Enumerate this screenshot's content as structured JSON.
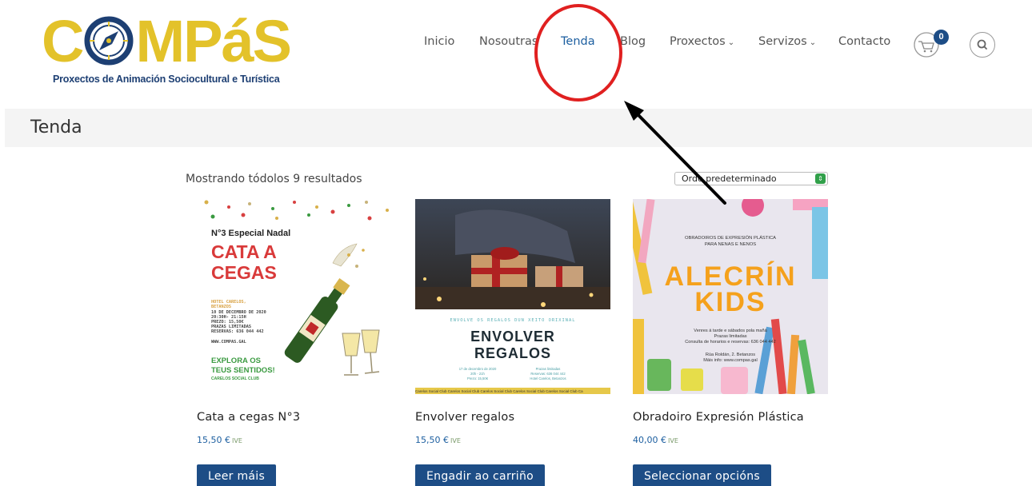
{
  "brand": {
    "logo_word_left": "C",
    "logo_word_right": "MPáS",
    "tagline": "Proxectos de Animación Sociocultural e Turística",
    "logo_color": "#e3c22a",
    "tag_color": "#1d3f73"
  },
  "nav": {
    "items": [
      {
        "label": "Inicio",
        "dropdown": false
      },
      {
        "label": "Nosoutras",
        "dropdown": false
      },
      {
        "label": "Tenda",
        "dropdown": false,
        "active": true
      },
      {
        "label": "Blog",
        "dropdown": false
      },
      {
        "label": "Proxectos",
        "dropdown": true
      },
      {
        "label": "Servizos",
        "dropdown": true
      },
      {
        "label": "Contacto",
        "dropdown": false
      }
    ],
    "cart_count": "0",
    "cart_icon": "cart-icon",
    "search_icon": "search-icon"
  },
  "page": {
    "title": "Tenda"
  },
  "shop": {
    "result_count": "Mostrando tódolos 9 resultados",
    "orderby_selected": "Orde predeterminado",
    "products": [
      {
        "name": "Cata a cegas N°3",
        "price": "15,50 €",
        "tax": "IVE",
        "button": "Leer máis",
        "image": {
          "heading": "N°3 Especial Nadal",
          "title_lines": [
            "CATA A",
            "CEGAS"
          ],
          "details": [
            "HOTEL CARELOS,",
            "BETANZOS",
            "10 DE DECEMBRO DE 2020",
            "20:30H- 21:15H",
            "PREZO: 15,50€",
            "PRAZAS LIMITADAS",
            "RESERVAS: 636 044 442"
          ],
          "web": "WWW.COMPAS.GAL",
          "cta_lines": [
            "EXPLORA OS",
            "TEUS SENTIDOS!"
          ],
          "footer": "CARELOS SOCIAL CLUB"
        }
      },
      {
        "name": "Envolver regalos",
        "price": "15,50 €",
        "tax": "IVE",
        "button": "Engadir ao carriño",
        "image": {
          "subtitle": "ENVOLVE OS REGALOS DUN XEITO ORIXINAL",
          "title_lines": [
            "ENVOLVER",
            "REGALOS"
          ],
          "left_info": [
            "17 de decembro de 2020",
            "20h - 21h",
            "Prezo: 15,50€"
          ],
          "right_info": [
            "Prazas limitadas",
            "Reservas: 636 044 442",
            "Hotel Carelos, Betanzos"
          ],
          "footer": "Carelos Social Club  Carelos Social Club  Carelos Social Club  Carelos Social Club  Carelos Social Club  Ca"
        }
      },
      {
        "name": "Obradoiro Expresión Plástica",
        "price": "40,00 €",
        "tax": "IVE",
        "button": "Seleccionar opcións",
        "image": {
          "subtitle_lines": [
            "OBRADOIROS DE EXPRESIÓN PLÁSTICA",
            "PARA NENAS E NENOS"
          ],
          "title_lines": [
            "ALECRÍN",
            "KIDS"
          ],
          "details": [
            "Venres á tarde e sábados pola mañá",
            "Prazas limitadas",
            "Consulta de horarios e reservas: 636 044 442",
            "",
            "Rúa Roldán, 2. Betanzos",
            "Máis info: www.compas.gal"
          ]
        }
      }
    ]
  },
  "colors": {
    "accent_blue": "#1d4d86",
    "nav_active": "#1d5fa0",
    "annotation_red": "#e02020"
  }
}
